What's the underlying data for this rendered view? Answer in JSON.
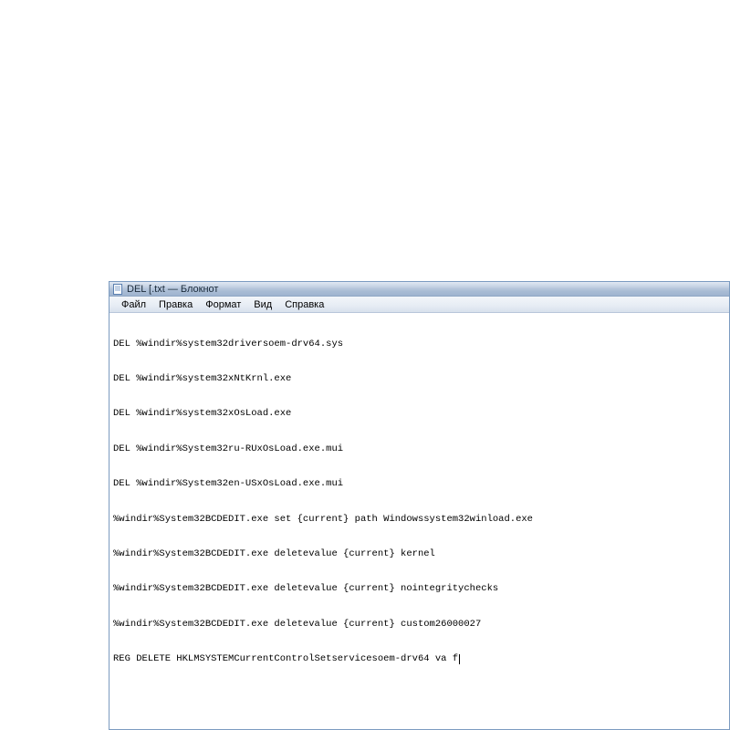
{
  "window": {
    "title": "DEL [.txt — Блокнот"
  },
  "menu": {
    "file": "Файл",
    "edit": "Правка",
    "format": "Формат",
    "view": "Вид",
    "help": "Справка"
  },
  "content": {
    "lines": [
      "DEL %windir%system32driversoem-drv64.sys",
      "DEL %windir%system32xNtKrnl.exe",
      "DEL %windir%system32xOsLoad.exe",
      "DEL %windir%System32ru-RUxOsLoad.exe.mui",
      "DEL %windir%System32en-USxOsLoad.exe.mui",
      "%windir%System32BCDEDIT.exe set {current} path Windowssystem32winload.exe",
      "%windir%System32BCDEDIT.exe deletevalue {current} kernel",
      "%windir%System32BCDEDIT.exe deletevalue {current} nointegritychecks",
      "%windir%System32BCDEDIT.exe deletevalue {current} custom26000027",
      "REG DELETE HKLMSYSTEMCurrentControlSetservicesoem-drv64 va f"
    ]
  }
}
